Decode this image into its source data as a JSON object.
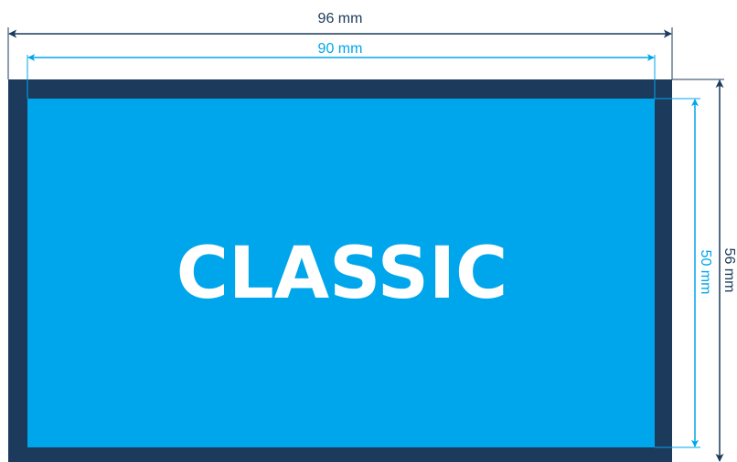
{
  "card": {
    "label": "CLASSIC"
  },
  "dimensions": {
    "outer_width": "96 mm",
    "inner_width": "90 mm",
    "inner_height": "50 mm",
    "outer_height": "56 mm"
  },
  "colors": {
    "bleed_border": "#1b3a5c",
    "card_fill": "#00a6eb",
    "outer_dimension": "#1b3a5c",
    "inner_dimension": "#00a6eb",
    "card_text": "#ffffff"
  }
}
